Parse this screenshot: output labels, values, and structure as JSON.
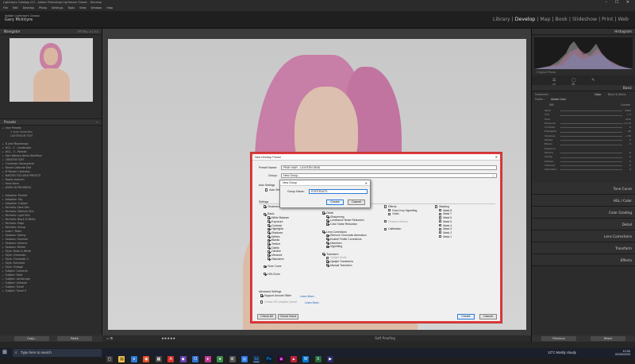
{
  "window": {
    "title": "Lightroom Catalog-v12 - Adobe Photoshop Lightroom Classic - Develop",
    "controls": "– ☐ ✕",
    "menu": [
      "File",
      "Edit",
      "Develop",
      "Photo",
      "Settings",
      "Tools",
      "View",
      "Window",
      "Help"
    ]
  },
  "identity": {
    "line1": "Adobe Lightroom Classic",
    "name": "Gary McIntyre"
  },
  "modules": [
    {
      "label": "Library",
      "active": false
    },
    {
      "label": "|",
      "active": false
    },
    {
      "label": "Develop",
      "active": true
    },
    {
      "label": "|",
      "active": false
    },
    {
      "label": "Map",
      "active": false
    },
    {
      "label": "|",
      "active": false
    },
    {
      "label": "Book",
      "active": false
    },
    {
      "label": "|",
      "active": false
    },
    {
      "label": "Slideshow",
      "active": false
    },
    {
      "label": "|",
      "active": false
    },
    {
      "label": "Print",
      "active": false
    },
    {
      "label": "|",
      "active": false
    },
    {
      "label": "Web",
      "active": false
    }
  ],
  "left_panel": {
    "navigator_title": "Navigator",
    "navigator_zoom": "FIT  FILL  1:1  3:1",
    "presets_title": "Presets",
    "presets": [
      {
        "label": "User Presets",
        "sub": false
      },
      {
        "label": "1 Lens Correction",
        "sub": true
      },
      {
        "label": "LIGHTROOM TEXT",
        "sub": true
      },
      {
        "label": "",
        "sub": false
      },
      {
        "label": "B Leaf Moviemaps",
        "sub": false
      },
      {
        "label": "#GL - 1 - Landscape",
        "sub": false
      },
      {
        "label": "#GL - 3 - Portrait",
        "sub": false
      },
      {
        "label": "Alex Wallace Aerial Workflow",
        "sub": false
      },
      {
        "label": "CREATIVE EDIT",
        "sub": false
      },
      {
        "label": "Cinematic Atmosphere",
        "sub": false
      },
      {
        "label": "Nicole Calibrate Edit",
        "sub": false
      },
      {
        "label": "JP Master Collection",
        "sub": false
      },
      {
        "label": "MASTER FOCUSED PRESETS",
        "sub": false
      },
      {
        "label": "Raster Autumn",
        "sub": false
      },
      {
        "label": "Terra Nova",
        "sub": false
      },
      {
        "label": "WORK IN PROGRESS",
        "sub": false
      },
      {
        "label": "",
        "sub": false
      },
      {
        "label": "Adaptive: Portrait",
        "sub": false
      },
      {
        "label": "Adaptive: Sky",
        "sub": false
      },
      {
        "label": "Adaptive: Subject",
        "sub": false
      },
      {
        "label": "Portraits: Dark Skin",
        "sub": false
      },
      {
        "label": "Portraits: Medium Skin",
        "sub": false
      },
      {
        "label": "Portraits: Light Skin",
        "sub": false
      },
      {
        "label": "Portraits: Black & White",
        "sub": false
      },
      {
        "label": "Portraits: Edge",
        "sub": false
      },
      {
        "label": "Portraits: Group",
        "sub": false
      },
      {
        "label": "Auto+: Retro",
        "sub": false
      },
      {
        "label": "Seasons: Spring",
        "sub": false
      },
      {
        "label": "Seasons: Summer",
        "sub": false
      },
      {
        "label": "Seasons: Autumn",
        "sub": false
      },
      {
        "label": "Seasons: Winter",
        "sub": false
      },
      {
        "label": "Style: Black & White",
        "sub": false
      },
      {
        "label": "Style: Cinematic",
        "sub": false
      },
      {
        "label": "Style: Cinematic II",
        "sub": false
      },
      {
        "label": "Style: Futuristic",
        "sub": false
      },
      {
        "label": "Style: Vintage",
        "sub": false
      },
      {
        "label": "Subject: Concerts",
        "sub": false
      },
      {
        "label": "Subject: Food",
        "sub": false
      },
      {
        "label": "Subject: Landscape",
        "sub": false
      },
      {
        "label": "Subject: Lifestyle",
        "sub": false
      },
      {
        "label": "Subject: Travel",
        "sub": false
      },
      {
        "label": "Subject: Travel II",
        "sub": false
      }
    ],
    "copy_label": "Copy...",
    "paste_label": "Paste"
  },
  "right_panel": {
    "histogram_title": "Histogram",
    "original_photo": "Original Photo",
    "basic_title": "Basic",
    "treatment": "Treatment :",
    "treatment_color": "Color",
    "treatment_bw": "Black & White",
    "profile_label": "Profile :",
    "profile_value": "Adobe Color",
    "wb_label": "WB :",
    "wb_value": "Custom",
    "sliders": [
      {
        "label": "Temp",
        "value": "4400"
      },
      {
        "label": "Tint",
        "value": "+ 4"
      },
      {
        "label": "Tone",
        "value": "Auto"
      },
      {
        "label": "Exposure",
        "value": "+ 0.70"
      },
      {
        "label": "Contrast",
        "value": "0"
      },
      {
        "label": "Highlights",
        "value": "- 40"
      },
      {
        "label": "Shadows",
        "value": "+ 30"
      },
      {
        "label": "Whites",
        "value": "0"
      },
      {
        "label": "Blacks",
        "value": "0"
      },
      {
        "label": "Presence",
        "value": ""
      },
      {
        "label": "Texture",
        "value": "0"
      },
      {
        "label": "Clarity",
        "value": "0"
      },
      {
        "label": "Dehaze",
        "value": "0"
      },
      {
        "label": "Vibrance",
        "value": "0"
      },
      {
        "label": "Saturation",
        "value": "0"
      }
    ],
    "sections": [
      "Tone Curve",
      "HSL / Color",
      "Color Grading",
      "Detail",
      "Lens Corrections",
      "Transform",
      "Effects"
    ],
    "previous_label": "Previous",
    "reset_label": "Reset"
  },
  "toolbar": {
    "stars": "★★★★★",
    "soft_proofing": "Soft Proofing"
  },
  "dialog": {
    "title": "New Develop Preset",
    "close": "✕",
    "preset_name_label": "Preset Name:",
    "preset_name_value": "PINK HAIR - LIGHTEN SKIN",
    "group_label": "Group:",
    "group_value": "New Group...",
    "auto_settings_label": "Auto Settings",
    "auto_settings_item": "Auto Settings",
    "settings_label": "Settings",
    "col1": [
      {
        "label": "Treatment & Profile",
        "on": true,
        "indent": 0
      },
      {
        "label": "",
        "on": false,
        "indent": 0
      },
      {
        "label": "Basic",
        "on": true,
        "indent": 0
      },
      {
        "label": "White Balance",
        "on": true,
        "indent": 1
      },
      {
        "label": "Exposure",
        "on": true,
        "indent": 1
      },
      {
        "label": "Contrast",
        "on": true,
        "indent": 1
      },
      {
        "label": "Highlights",
        "on": true,
        "indent": 1
      },
      {
        "label": "Shadows",
        "on": true,
        "indent": 1
      },
      {
        "label": "Whites",
        "on": true,
        "indent": 1
      },
      {
        "label": "Blacks",
        "on": true,
        "indent": 1
      },
      {
        "label": "Texture",
        "on": true,
        "indent": 1
      },
      {
        "label": "Clarity",
        "on": true,
        "indent": 1
      },
      {
        "label": "Dehaze",
        "on": true,
        "indent": 1
      },
      {
        "label": "Vibrance",
        "on": true,
        "indent": 1
      },
      {
        "label": "Saturation",
        "on": true,
        "indent": 1
      },
      {
        "label": "",
        "on": false,
        "indent": 0
      },
      {
        "label": "Tone Curve",
        "on": true,
        "indent": 0
      },
      {
        "label": "",
        "on": false,
        "indent": 0
      },
      {
        "label": "HSL/Color",
        "on": true,
        "indent": 0
      }
    ],
    "col2": [
      {
        "label": "Detail",
        "on": true,
        "indent": 0,
        "dim": false
      },
      {
        "label": "Sharpening",
        "on": true,
        "indent": 1,
        "dim": false
      },
      {
        "label": "Luminance Noise Reduction",
        "on": true,
        "indent": 1,
        "dim": false
      },
      {
        "label": "Color Noise Reduction",
        "on": true,
        "indent": 1,
        "dim": false
      },
      {
        "label": "",
        "on": false,
        "indent": 0,
        "dim": false
      },
      {
        "label": "Lens Corrections",
        "on": true,
        "indent": 0,
        "dim": false
      },
      {
        "label": "Remove Chromatic Aberration",
        "on": true,
        "indent": 1,
        "dim": false
      },
      {
        "label": "Enable Profile Corrections",
        "on": true,
        "indent": 1,
        "dim": false
      },
      {
        "label": "Distortion",
        "on": true,
        "indent": 1,
        "dim": false
      },
      {
        "label": "Vignetting",
        "on": true,
        "indent": 1,
        "dim": false
      },
      {
        "label": "",
        "on": false,
        "indent": 0,
        "dim": false
      },
      {
        "label": "Transform",
        "on": true,
        "indent": 0,
        "dim": false
      },
      {
        "label": "Upright Mode",
        "on": false,
        "indent": 1,
        "dim": true
      },
      {
        "label": "Upright Transforms",
        "on": true,
        "indent": 1,
        "dim": false
      },
      {
        "label": "Manual Transform",
        "on": true,
        "indent": 1,
        "dim": false
      }
    ],
    "col3": [
      {
        "label": "Effects",
        "on": false,
        "indent": 0,
        "dim": false
      },
      {
        "label": "Post-Crop Vignetting",
        "on": false,
        "indent": 1,
        "dim": false
      },
      {
        "label": "Grain",
        "on": false,
        "indent": 1,
        "dim": false
      },
      {
        "label": "",
        "on": false,
        "indent": 0,
        "dim": false
      },
      {
        "label": "Process Version",
        "on": false,
        "indent": 0,
        "dim": true
      },
      {
        "label": "",
        "on": false,
        "indent": 0,
        "dim": false
      },
      {
        "label": "Calibration",
        "on": false,
        "indent": 0,
        "dim": false
      }
    ],
    "col4": [
      {
        "label": "Masking",
        "on": false,
        "indent": 0
      },
      {
        "label": "Mask 8",
        "on": false,
        "indent": 1
      },
      {
        "label": "Mask 7",
        "on": false,
        "indent": 1
      },
      {
        "label": "Mask 6",
        "on": false,
        "indent": 1
      },
      {
        "label": "Mask 5",
        "on": false,
        "indent": 1
      },
      {
        "label": "Mask 4",
        "on": false,
        "indent": 1
      },
      {
        "label": "Mask 3",
        "on": false,
        "indent": 1
      },
      {
        "label": "Mask 2",
        "on": false,
        "indent": 1
      },
      {
        "label": "Mask 1",
        "on": false,
        "indent": 1
      }
    ],
    "advanced_label": "Advanced Settings",
    "support_amount_slider": "Support Amount Slider",
    "create_hdr": "Create ISO adaptive preset",
    "learn_more_1": "Learn More...",
    "learn_more_2": "Learn More...",
    "check_all": "Check All",
    "check_none": "Check None",
    "create": "Create",
    "cancel": "Cancel"
  },
  "new_group": {
    "title": "New Group",
    "close": "✕",
    "name_label": "Group Name:",
    "name_value": "PORTRAITS",
    "create": "Create",
    "cancel": "Cancel"
  },
  "taskbar": {
    "search_placeholder": "Type here to search",
    "weather": "13°C  Mostly cloudy",
    "time": "10:00",
    "date": "02/05/2023",
    "accent": "#2b7bd6"
  }
}
